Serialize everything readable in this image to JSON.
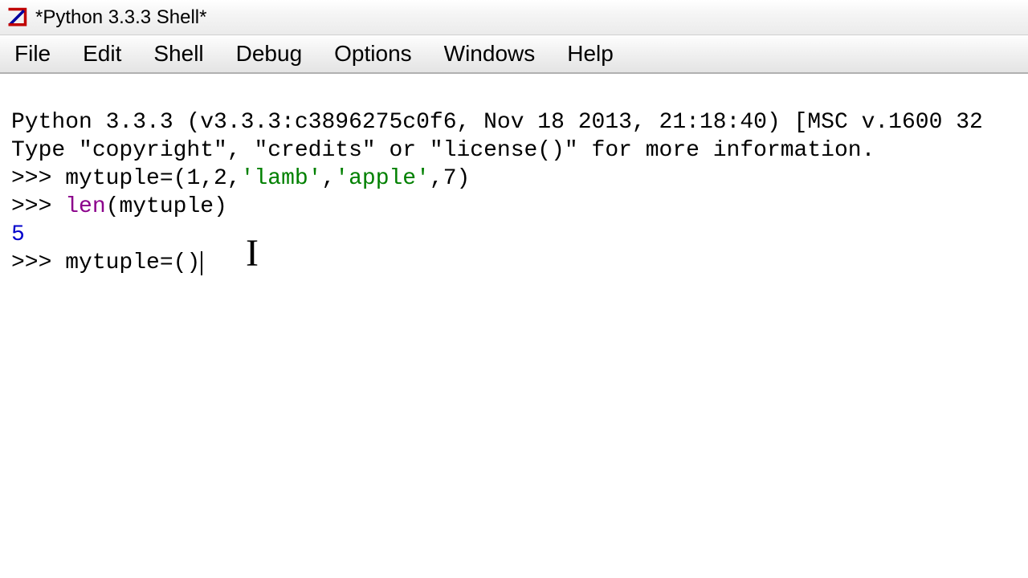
{
  "window": {
    "title": "*Python 3.3.3 Shell*"
  },
  "menu": {
    "file": "File",
    "edit": "Edit",
    "shell": "Shell",
    "debug": "Debug",
    "options": "Options",
    "windows": "Windows",
    "help": "Help"
  },
  "console": {
    "banner1": "Python 3.3.3 (v3.3.3:c3896275c0f6, Nov 18 2013, 21:18:40) [MSC v.1600 32",
    "banner2": "Type \"copyright\", \"credits\" or \"license()\" for more information.",
    "prompt": ">>> ",
    "line1_a": "mytuple=(1,2,",
    "line1_s1": "'lamb'",
    "line1_b": ",",
    "line1_s2": "'apple'",
    "line1_c": ",7)",
    "line2_fn": "len",
    "line2_rest": "(mytuple)",
    "out1": "5",
    "line3": "mytuple=()"
  }
}
